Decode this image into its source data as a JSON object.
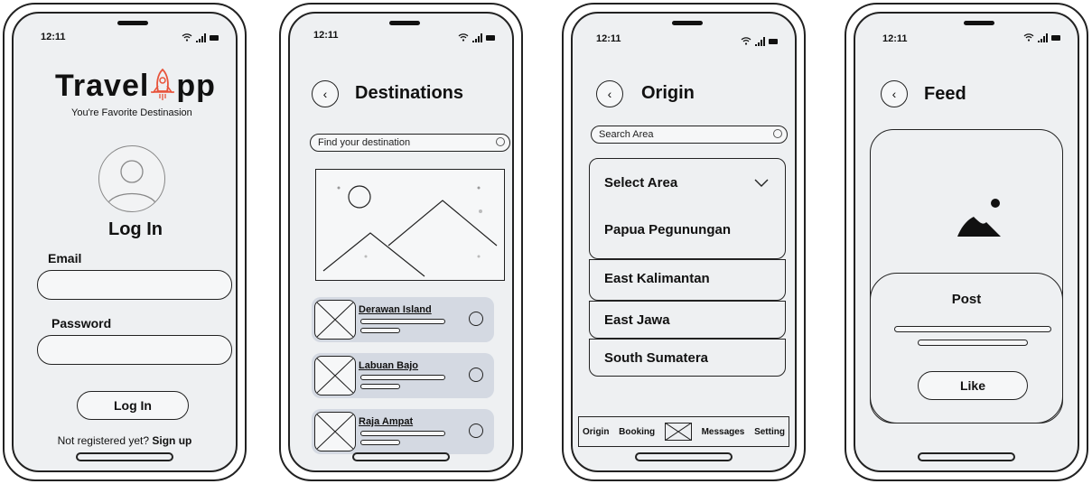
{
  "status_time": "12:11",
  "login": {
    "logo_text_1": "Travel",
    "logo_text_2": "pp",
    "tagline": "You're Favorite Destinasion",
    "heading": "Log In",
    "email_label": "Email",
    "email_value": "",
    "password_label": "Password",
    "password_value": "",
    "login_button": "Log In",
    "signup_prompt": "Not registered yet?",
    "signup_link": "Sign up"
  },
  "destinations": {
    "title": "Destinations",
    "search_placeholder": "Find your destination",
    "items": [
      {
        "name": "Derawan Island"
      },
      {
        "name": "Labuan Bajo"
      },
      {
        "name": "Raja Ampat"
      }
    ]
  },
  "origin": {
    "title": "Origin",
    "search_placeholder": "Search Area",
    "dropdown_label": "Select Area",
    "options": [
      "Papua Pegunungan",
      "East Kalimantan",
      "East Jawa",
      "South Sumatera"
    ],
    "nav": [
      "Origin",
      "Booking",
      "Messages",
      "Setting"
    ]
  },
  "feed": {
    "title": "Feed",
    "post_label": "Post",
    "like_button": "Like"
  },
  "colors": {
    "accent": "#e8533a",
    "card": "#d4d9e2",
    "screen": "#eef0f2"
  }
}
